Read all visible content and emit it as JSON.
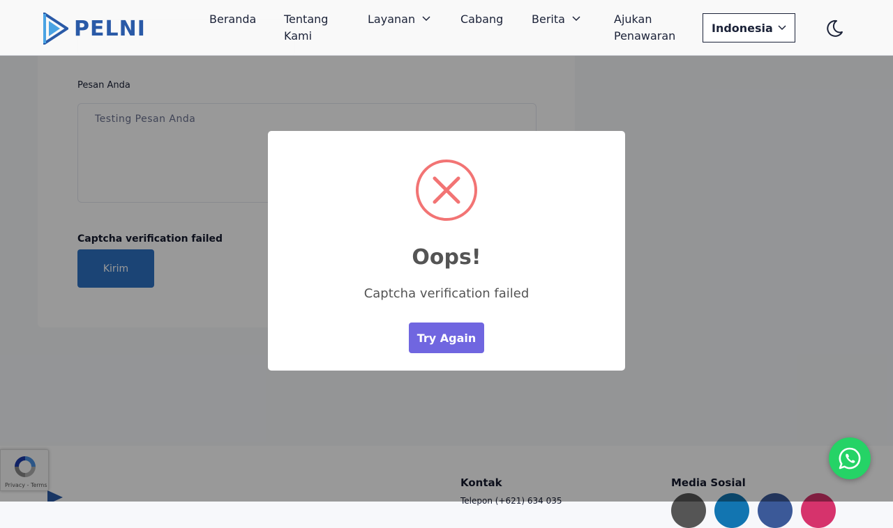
{
  "header": {
    "logo_text": "PELNI",
    "nav": [
      {
        "label": "Beranda"
      },
      {
        "label": "Tentang Kami"
      },
      {
        "label": "Layanan"
      },
      {
        "label": "Cabang"
      },
      {
        "label": "Berita"
      },
      {
        "label": "Ajukan Penawaran"
      }
    ],
    "language": "Indonesia"
  },
  "form": {
    "message_label": "Pesan Anda",
    "message_value": "Testing Pesan Anda",
    "error_text": "Captcha verification failed",
    "submit_label": "Kirim"
  },
  "modal": {
    "title": "Oops!",
    "text": "Captcha verification failed",
    "confirm_label": "Try Again",
    "icon": "error-x-icon",
    "icon_color": "#f27474",
    "confirm_color": "#7066e0"
  },
  "footer": {
    "contact_heading": "Kontak",
    "social_heading": "Media Sosial",
    "phone_line": "Telepon (+621) 634 035"
  },
  "recaptcha": {
    "links": "Privacy - Terms"
  },
  "colors": {
    "brand_blue": "#2a5aa7",
    "submit_blue": "#2e72c4",
    "whatsapp_green": "#25d366"
  }
}
